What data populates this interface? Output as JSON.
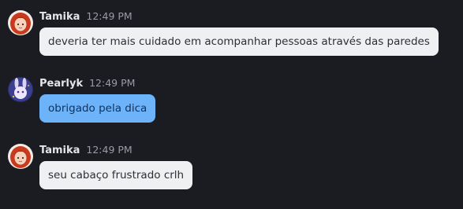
{
  "messages": [
    {
      "author": "Tamika",
      "time": "12:49 PM",
      "text": "deveria ter mais cuidado em acompanhar pessoas através das paredes",
      "avatar_icon": "redhead-avatar-icon",
      "bubble_color": "#eef0f2"
    },
    {
      "author": "Pearlyk",
      "time": "12:49 PM",
      "text": "obrigado pela dica",
      "avatar_icon": "bunny-avatar-icon",
      "bubble_color": "#6db3f9"
    },
    {
      "author": "Tamika",
      "time": "12:49 PM",
      "text": "seu cabaço frustrado crlh",
      "avatar_icon": "redhead-avatar-icon",
      "bubble_color": "#eef0f2"
    }
  ],
  "colors": {
    "background": "#1a1c22",
    "name_text": "#e3e5e8",
    "timestamp_text": "#9a9ca3"
  }
}
